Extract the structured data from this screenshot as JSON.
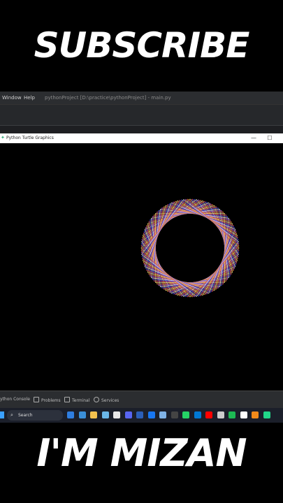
{
  "banner": {
    "top": "SUBSCRIBE",
    "bottom": "I'M MIZAN"
  },
  "ide": {
    "menu": [
      "Window",
      "Help"
    ],
    "project_title": "pythonProject [D:\\practice\\pythonProject] - main.py"
  },
  "turtle_window": {
    "title": "Python Turtle Graphics",
    "minimize": "—",
    "maximize": "☐"
  },
  "tool_tabs": [
    "ython Console",
    "Problems",
    "Terminal",
    "Services"
  ],
  "taskbar": {
    "search_label": "Search",
    "apps": [
      "edge-icon",
      "file-explorer-icon",
      "photos-icon",
      "chrome-icon",
      "discord-icon",
      "word-icon",
      "facebook-icon",
      "notepad-icon",
      "obs-icon",
      "whatsapp-icon",
      "store-icon",
      "youtube-icon",
      "notion-icon",
      "spotify-icon",
      "capcut-icon",
      "ide-icon",
      "vlc-icon",
      "pycharm-icon"
    ]
  },
  "colors": {
    "background": "#000000",
    "taskbar": "#1b1f2a",
    "ide": "#2b2d30",
    "search_accent": "#3aa0ff"
  }
}
